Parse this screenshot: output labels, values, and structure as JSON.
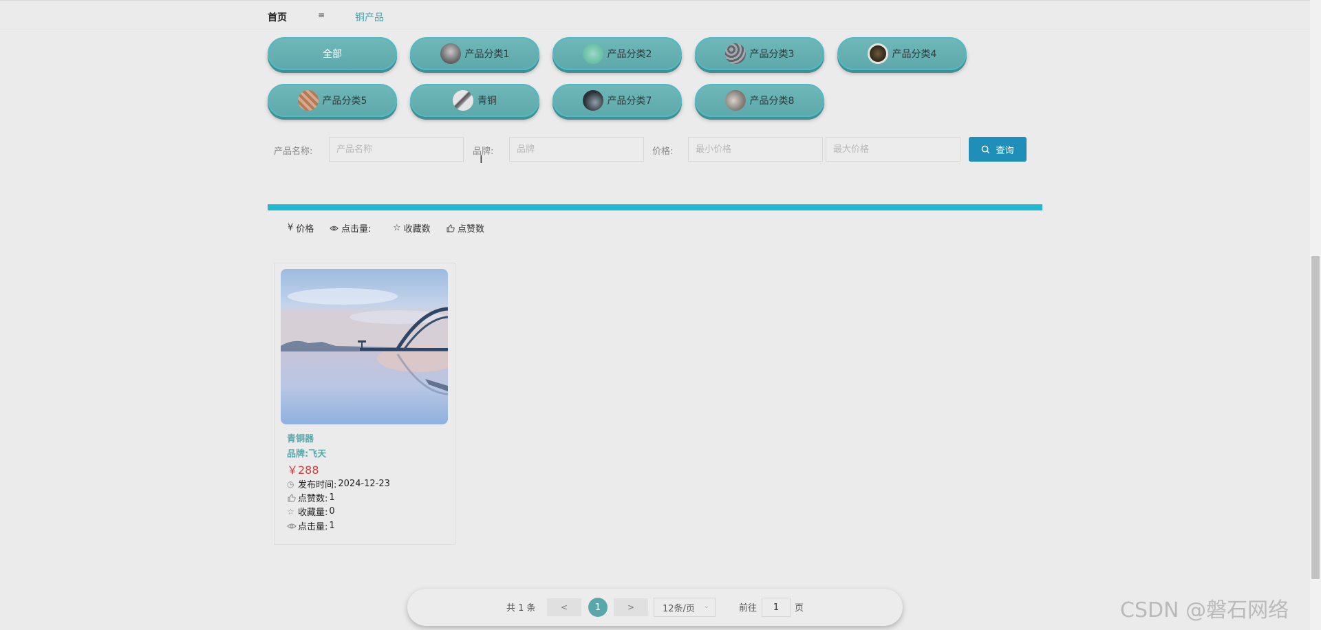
{
  "breadcrumb": {
    "home": "首页",
    "separator": "≡",
    "current": "铜产品"
  },
  "categories": [
    {
      "label": "全部",
      "thumb": ""
    },
    {
      "label": "产品分类1",
      "thumb": "coat-thumb"
    },
    {
      "label": "产品分类2",
      "thumb": "jade-thumb"
    },
    {
      "label": "产品分类3",
      "thumb": "stones-thumb"
    },
    {
      "label": "产品分类4",
      "thumb": "shield-thumb"
    },
    {
      "label": "产品分类5",
      "thumb": "copper-thumb"
    },
    {
      "label": "青铜",
      "thumb": "sword-thumb"
    },
    {
      "label": "产品分类7",
      "thumb": "dark-thumb"
    },
    {
      "label": "产品分类8",
      "thumb": "gray-thumb"
    }
  ],
  "search": {
    "name_label": "产品名称:",
    "name_placeholder": "产品名称",
    "brand_label": "品牌:",
    "brand_placeholder": "品牌",
    "price_label": "价格:",
    "min_placeholder": "最小价格",
    "max_placeholder": "最大价格",
    "query_label": "查询"
  },
  "sort": [
    {
      "icon": "¥",
      "label": "价格"
    },
    {
      "icon": "eye-icon",
      "label": "点击量:"
    },
    {
      "icon": "star-icon",
      "label": "收藏数"
    },
    {
      "icon": "thumbs-up-icon",
      "label": "点赞数"
    }
  ],
  "product": {
    "name": "青铜器",
    "brand": "品牌:飞天",
    "price": "￥288",
    "publish_label": "发布时间:",
    "publish_value": "2024-12-23",
    "likes_label": "点赞数:",
    "likes_value": "1",
    "favorites_label": "收藏量:",
    "favorites_value": "0",
    "clicks_label": "点击量:",
    "clicks_value": "1"
  },
  "pagination": {
    "total": "共 1 条",
    "prev": "<",
    "page": "1",
    "next": ">",
    "page_size": "12条/页",
    "goto_label": "前往",
    "goto_value": "1",
    "goto_unit": "页"
  },
  "watermark": "CSDN @磐石网络",
  "colors": {
    "accent": "#5aa7aa",
    "primary_button": "#1f8fb9",
    "divider": "#1fbad0",
    "price": "#d23b3b"
  }
}
